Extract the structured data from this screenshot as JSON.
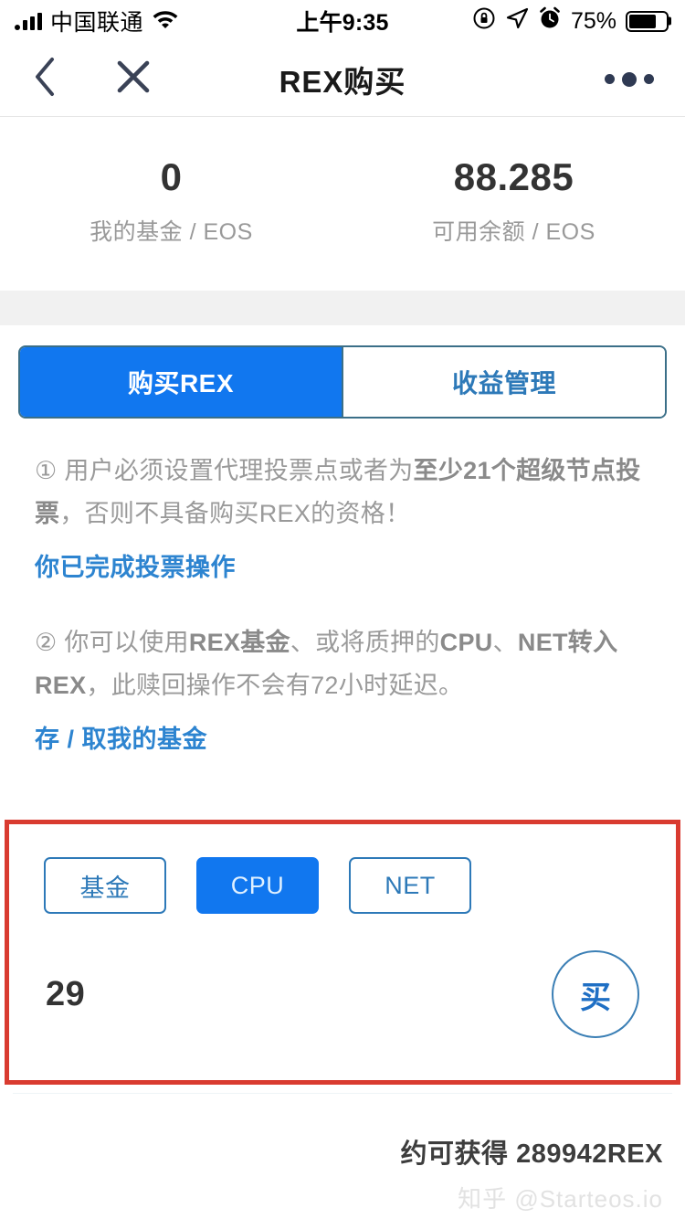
{
  "status_bar": {
    "carrier": "中国联通",
    "time": "上午9:35",
    "battery_percent": "75%",
    "battery_level": 75,
    "icons": [
      "signal-bars-icon",
      "wifi-icon",
      "rotation-lock-icon",
      "location-arrow-icon",
      "alarm-clock-icon",
      "battery-icon"
    ]
  },
  "nav": {
    "title": "REX购买",
    "back_icon": "back-chevron-icon",
    "close_icon": "close-x-icon",
    "more_icon": "more-dots-icon"
  },
  "stats": [
    {
      "value": "0",
      "label": "我的基金 / EOS"
    },
    {
      "value": "88.285",
      "label": "可用余额 / EOS"
    }
  ],
  "tabs": [
    {
      "label": "购买REX",
      "active": true
    },
    {
      "label": "收益管理",
      "active": false
    }
  ],
  "notes": [
    {
      "marker": "①",
      "segments": [
        {
          "text": " 用户必须设置代理投票点或者为",
          "bold": false
        },
        {
          "text": "至少21个超级节点投票",
          "bold": true
        },
        {
          "text": "，否则不具备购买REX的资格！",
          "bold": false
        }
      ],
      "link": "你已完成投票操作"
    },
    {
      "marker": "②",
      "segments": [
        {
          "text": " 你可以使用",
          "bold": false
        },
        {
          "text": "REX基金",
          "bold": true
        },
        {
          "text": "、或将质押的",
          "bold": false
        },
        {
          "text": "CPU",
          "bold": true
        },
        {
          "text": "、",
          "bold": false
        },
        {
          "text": "NET转入REX",
          "bold": true
        },
        {
          "text": "，此赎回操作不会有72小时延迟。",
          "bold": false
        }
      ],
      "link": "存 / 取我的基金"
    }
  ],
  "purchase": {
    "resource_chips": [
      {
        "label": "基金",
        "active": false
      },
      {
        "label": "CPU",
        "active": true
      },
      {
        "label": "NET",
        "active": false
      }
    ],
    "amount": "29",
    "buy_label": "买",
    "highlight_color": "#d93b30"
  },
  "footer": {
    "estimate": "约可获得 289942REX",
    "watermark": "知乎 @Starteos.io"
  },
  "colors": {
    "accent_blue": "#1177ef",
    "link_blue": "#2d84d0",
    "highlight_red": "#d93b30",
    "muted_text": "#9a9a9a"
  }
}
